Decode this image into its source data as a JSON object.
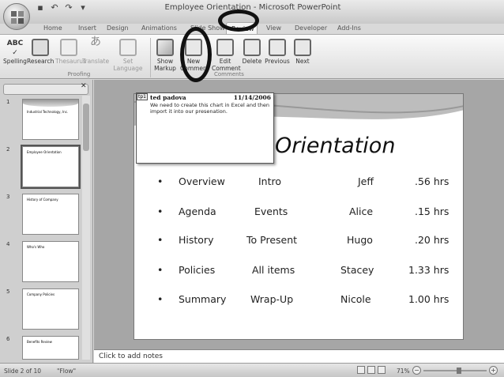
{
  "window": {
    "title": "Employee Orientation - Microsoft PowerPoint"
  },
  "qat": {
    "save_icon": "save-icon",
    "undo_icon": "undo-icon",
    "redo_icon": "redo-icon"
  },
  "tabs": [
    "Home",
    "Insert",
    "Design",
    "Animations",
    "Slide Show",
    "Review",
    "View",
    "Developer",
    "Add-Ins"
  ],
  "ribbon": {
    "proofing": {
      "label": "Proofing",
      "spelling": "Spelling",
      "research": "Research",
      "thesaurus": "Thesaurus",
      "translate": "Translate",
      "set_language": "Set Language"
    },
    "comments": {
      "label": "Comments",
      "show_markup": "Show Markup",
      "new_comment": "New Comment",
      "edit_comment": "Edit Comment",
      "delete": "Delete",
      "previous": "Previous",
      "next": "Next"
    }
  },
  "slides_pane": {
    "thumbs": [
      {
        "num": "1",
        "title": "Industrial Technology, Inc."
      },
      {
        "num": "2",
        "title": "Employee Orientation"
      },
      {
        "num": "3",
        "title": "History of Company"
      },
      {
        "num": "4",
        "title": "Who's Who"
      },
      {
        "num": "5",
        "title": "Company Policies"
      },
      {
        "num": "6",
        "title": "Benefits Review"
      }
    ]
  },
  "slide": {
    "title": "Orientation",
    "rows": [
      {
        "bullet": "•",
        "topic": "Overview",
        "desc": "Intro",
        "presenter": "Jeff",
        "time": ".56 hrs"
      },
      {
        "bullet": "•",
        "topic": "Agenda",
        "desc": "Events",
        "presenter": "Alice",
        "time": ".15 hrs"
      },
      {
        "bullet": "•",
        "topic": "History",
        "desc": "To Present",
        "presenter": "Hugo",
        "time": ".20 hrs"
      },
      {
        "bullet": "•",
        "topic": "Policies",
        "desc": "All items",
        "presenter": "Stacey",
        "time": "1.33 hrs"
      },
      {
        "bullet": "•",
        "topic": "Summary",
        "desc": "Wrap-Up",
        "presenter": "Nicole",
        "time": "1.00 hrs"
      }
    ]
  },
  "comment": {
    "tag": "tp1",
    "author": "ted padova",
    "date": "11/14/2006",
    "text": "We need to create this chart in Excel and then import it into our presenation."
  },
  "notes": {
    "placeholder": "Click to add notes"
  },
  "status": {
    "slide": "Slide 2 of 10",
    "theme": "\"Flow\"",
    "zoom": "71%"
  }
}
